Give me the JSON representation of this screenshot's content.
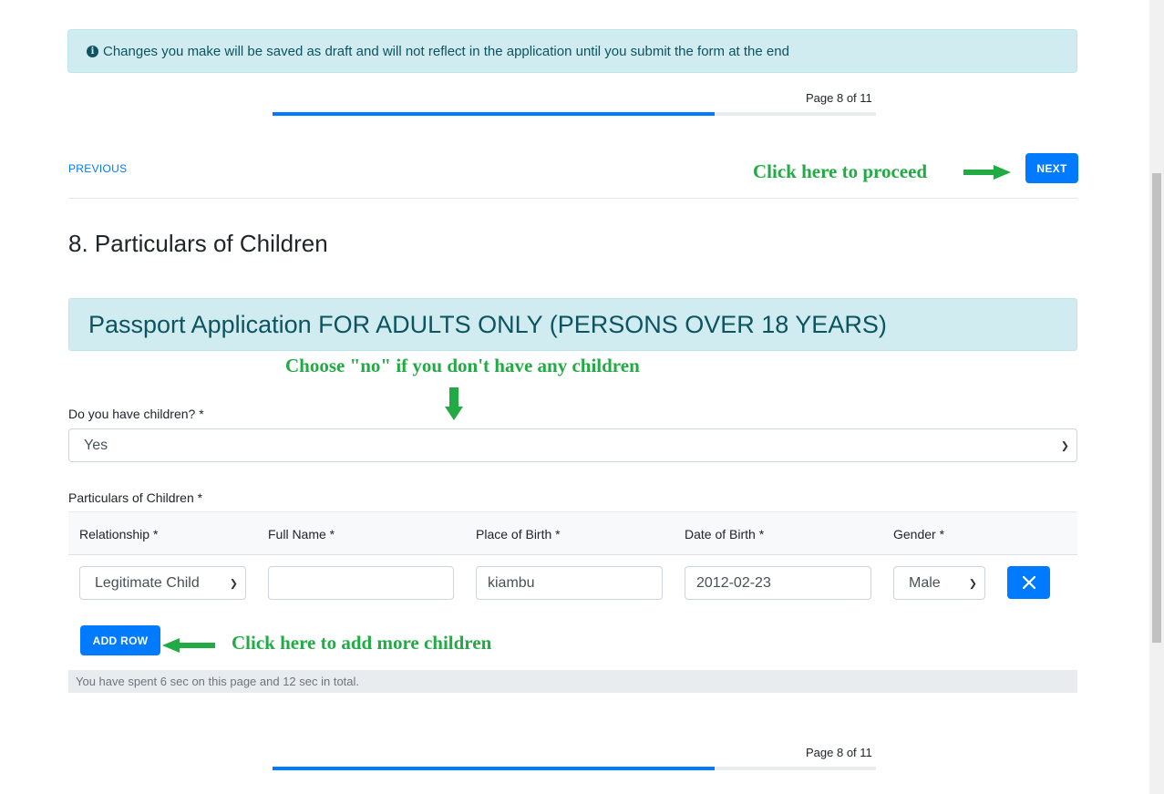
{
  "notice": {
    "icon": "info-circle-icon",
    "text": "Changes you make will be saved as draft and will not reflect in the application until you submit the form at the end"
  },
  "pagination": {
    "top_label": "Page 8 of 11",
    "bottom_label": "Page 8 of 11",
    "progress_fraction": 0.733
  },
  "nav": {
    "previous_label": "PREVIOUS",
    "next_label": "NEXT"
  },
  "annotations": {
    "proceed": "Click here to proceed",
    "choose_no": "Choose \"no\" if you don't have any children",
    "add_more": "Click here to add more children",
    "arrow_color": "#22aa44"
  },
  "section": {
    "title": "8. Particulars of Children",
    "banner": "Passport Application FOR ADULTS ONLY (PERSONS OVER 18 YEARS)"
  },
  "form": {
    "has_children_label": "Do you have children? *",
    "has_children_value": "Yes",
    "particulars_label": "Particulars of Children *",
    "columns": [
      "Relationship *",
      "Full Name *",
      "Place of Birth *",
      "Date of Birth *",
      "Gender *"
    ],
    "rows": [
      {
        "relationship": "Legitimate Child",
        "full_name": "",
        "place_of_birth": "kiambu",
        "date_of_birth": "2012-02-23",
        "gender": "Male"
      }
    ],
    "add_row_label": "ADD ROW",
    "remove_icon": "close-icon"
  },
  "timer_text": "You have spent 6 sec on this page and 12 sec in total.",
  "colors": {
    "primary": "#007bff",
    "info_bg": "#d1ecf1",
    "info_text": "#0c5460"
  }
}
